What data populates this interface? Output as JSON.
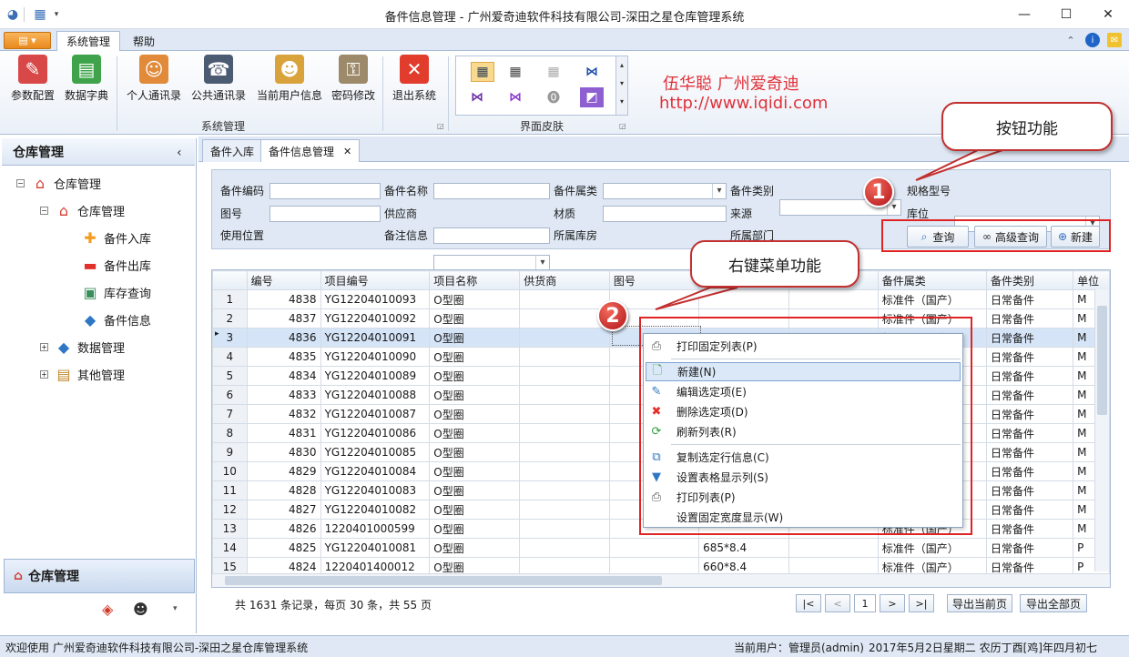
{
  "window": {
    "title": "备件信息管理 - 广州爱奇迪软件科技有限公司-深田之星仓库管理系统"
  },
  "ribbon": {
    "tabs": [
      {
        "label": "系统管理"
      },
      {
        "label": "帮助"
      }
    ],
    "buttons": [
      {
        "label": "参数配置",
        "icon": "settings-icon"
      },
      {
        "label": "数据字典",
        "icon": "books-icon"
      },
      {
        "label": "个人通讯录",
        "icon": "contact-card-icon"
      },
      {
        "label": "公共通讯录",
        "icon": "address-book-icon"
      },
      {
        "label": "当前用户信息",
        "icon": "user-info-icon"
      },
      {
        "label": "密码修改",
        "icon": "key-icon"
      },
      {
        "label": "退出系统",
        "icon": "exit-icon"
      }
    ],
    "group_system": "系统管理",
    "group_skin": "界面皮肤"
  },
  "brand": {
    "line1": "伍华聪  广州爱奇迪",
    "line2": "http://www.iqidi.com"
  },
  "left": {
    "title": "仓库管理",
    "tree": [
      {
        "label": "仓库管理",
        "level": 0,
        "icon": "warehouse-icon"
      },
      {
        "label": "仓库管理",
        "level": 1,
        "icon": "warehouse-icon"
      },
      {
        "label": "备件入库",
        "level": 2,
        "icon": "plus-icon"
      },
      {
        "label": "备件出库",
        "level": 2,
        "icon": "minus-icon"
      },
      {
        "label": "库存查询",
        "level": 2,
        "icon": "inventory-icon"
      },
      {
        "label": "备件信息",
        "level": 2,
        "icon": "parts-icon"
      },
      {
        "label": "数据管理",
        "level": 1,
        "icon": "data-icon"
      },
      {
        "label": "其他管理",
        "level": 1,
        "icon": "other-icon"
      }
    ],
    "footer": "仓库管理"
  },
  "doctabs": [
    {
      "label": "备件入库"
    },
    {
      "label": "备件信息管理"
    }
  ],
  "filter": {
    "labels": [
      "备件编码",
      "备件名称",
      "备件属类",
      "备件类别",
      "规格型号",
      "图号",
      "供应商",
      "材质",
      "来源",
      "库位",
      "使用位置",
      "备注信息",
      "所属库房",
      "所属部门"
    ],
    "buttons": {
      "query": "查询",
      "advanced": "高级查询",
      "new": "新建"
    }
  },
  "grid": {
    "columns": [
      "编号",
      "项目编号",
      "项目名称",
      "供货商",
      "图号",
      "",
      "",
      "备件属类",
      "备件类别",
      "单位"
    ],
    "rows": [
      [
        "1",
        "4838",
        "YG12204010093",
        "O型圈",
        "",
        "",
        "",
        "",
        "标准件（国产）",
        "日常备件",
        "M"
      ],
      [
        "2",
        "4837",
        "YG12204010092",
        "O型圈",
        "",
        "",
        "",
        "",
        "标准件（国产）",
        "日常备件",
        "M"
      ],
      [
        "3",
        "4836",
        "YG12204010091",
        "O型圈",
        "",
        "",
        "",
        "",
        "标准件（国产）",
        "日常备件",
        "M"
      ],
      [
        "4",
        "4835",
        "YG12204010090",
        "O型圈",
        "",
        "",
        "",
        "",
        "",
        "日常备件",
        "M"
      ],
      [
        "5",
        "4834",
        "YG12204010089",
        "O型圈",
        "",
        "",
        "",
        "",
        "",
        "日常备件",
        "M"
      ],
      [
        "6",
        "4833",
        "YG12204010088",
        "O型圈",
        "",
        "",
        "",
        "",
        "",
        "日常备件",
        "M"
      ],
      [
        "7",
        "4832",
        "YG12204010087",
        "O型圈",
        "",
        "",
        "",
        "",
        "",
        "日常备件",
        "M"
      ],
      [
        "8",
        "4831",
        "YG12204010086",
        "O型圈",
        "",
        "",
        "",
        "",
        "",
        "日常备件",
        "M"
      ],
      [
        "9",
        "4830",
        "YG12204010085",
        "O型圈",
        "",
        "",
        "",
        "",
        "",
        "日常备件",
        "M"
      ],
      [
        "10",
        "4829",
        "YG12204010084",
        "O型圈",
        "",
        "",
        "",
        "",
        "",
        "日常备件",
        "M"
      ],
      [
        "11",
        "4828",
        "YG12204010083",
        "O型圈",
        "",
        "",
        "",
        "",
        "",
        "日常备件",
        "M"
      ],
      [
        "12",
        "4827",
        "YG12204010082",
        "O型圈",
        "",
        "",
        "",
        "",
        "",
        "日常备件",
        "M"
      ],
      [
        "13",
        "4826",
        "1220401000599",
        "O型圈",
        "",
        "",
        "",
        "",
        "标准件（国产）",
        "日常备件",
        "M"
      ],
      [
        "14",
        "4825",
        "YG12204010081",
        "O型圈",
        "",
        "",
        "685*8.4",
        "",
        "标准件（国产）",
        "日常备件",
        "P"
      ],
      [
        "15",
        "4824",
        "1220401400012",
        "O型圈",
        "",
        "",
        "660*8.4",
        "",
        "标准件（国产）",
        "日常备件",
        "P"
      ]
    ]
  },
  "context_menu": [
    {
      "label": "打印固定列表(P)",
      "icon": "printer-icon"
    },
    {
      "label": "新建(N)",
      "icon": "new-doc-icon"
    },
    {
      "label": "编辑选定项(E)",
      "icon": "edit-icon"
    },
    {
      "label": "删除选定项(D)",
      "icon": "delete-icon"
    },
    {
      "label": "刷新列表(R)",
      "icon": "refresh-icon"
    },
    {
      "label": "复制选定行信息(C)",
      "icon": "copy-icon"
    },
    {
      "label": "设置表格显示列(S)",
      "icon": "filter-icon"
    },
    {
      "label": "打印列表(P)",
      "icon": "printer-icon"
    },
    {
      "label": "设置固定宽度显示(W)",
      "icon": ""
    }
  ],
  "callouts": {
    "button_function": "按钮功能",
    "context_function": "右键菜单功能",
    "badge1": "1",
    "badge2": "2"
  },
  "pager": {
    "summary": "共 1631 条记录，每页 30 条，共 55 页",
    "page": "1",
    "first": "|<",
    "prev": "<",
    "next": ">",
    "last": ">|",
    "export_current": "导出当前页",
    "export_all": "导出全部页"
  },
  "status": {
    "welcome": "欢迎使用 广州爱奇迪软件科技有限公司-深田之星仓库管理系统",
    "user": "当前用户：管理员(admin)",
    "date": "2017年5月2日星期二 农历丁酉[鸡]年四月初七"
  },
  "colors": {
    "accent": "#3b6fb6",
    "callout_border": "#c23030",
    "brand": "#e0313a",
    "selected_row": "#d5e4f7"
  }
}
